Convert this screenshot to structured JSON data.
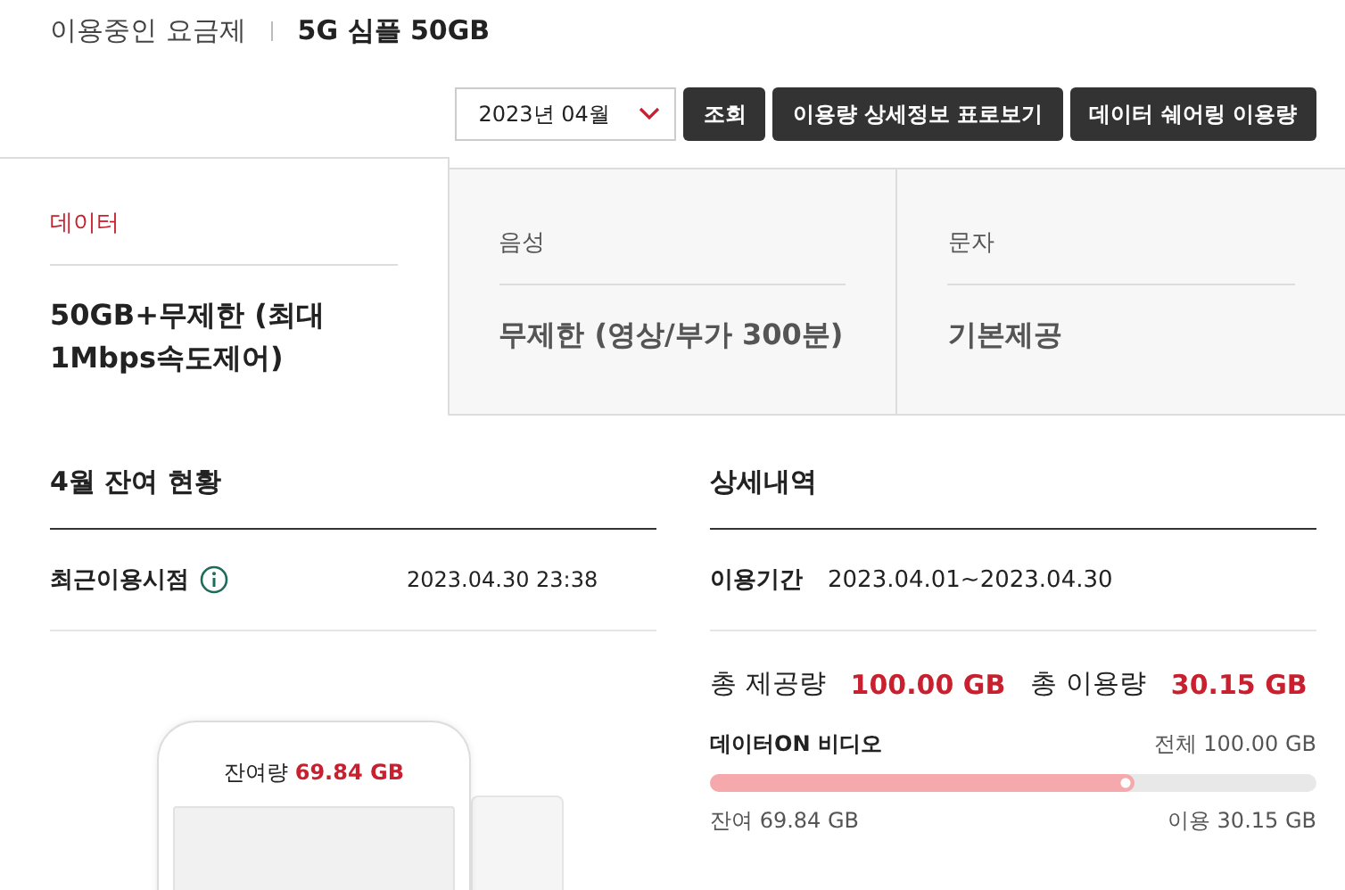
{
  "plan": {
    "label": "이용중인 요금제",
    "name": "5G 심플 50GB"
  },
  "controls": {
    "month_select": {
      "value": "2023년 04월"
    },
    "buttons": [
      "조회",
      "이용량 상세정보 표로보기",
      "데이터 쉐어링 이용량"
    ]
  },
  "tabs": [
    {
      "label": "데이터",
      "value": "50GB+무제한 (최대 1Mbps속도제어)",
      "selected": true
    },
    {
      "label": "음성",
      "value": "무제한 (영상/부가 300분)",
      "selected": false
    },
    {
      "label": "문자",
      "value": "기본제공",
      "selected": false
    }
  ],
  "remaining": {
    "title": "4월 잔여 현황",
    "recent_label": "최근이용시점",
    "recent_value": "2023.04.30 23:38",
    "phone_label": "잔여량",
    "phone_value": "69.84 GB"
  },
  "details": {
    "title": "상세내역",
    "period_label": "이용기간",
    "period_value": "2023.04.01~2023.04.30",
    "total_provided_label": "총 제공량",
    "total_provided": "100.00 GB",
    "total_used_label": "총 이용량",
    "total_used": "30.15 GB",
    "meters": [
      {
        "name": "데이터ON 비디오",
        "total": "전체 100.00 GB",
        "remaining": "잔여 69.84 GB",
        "used": "이용 30.15 GB",
        "level": 0.7
      }
    ]
  }
}
